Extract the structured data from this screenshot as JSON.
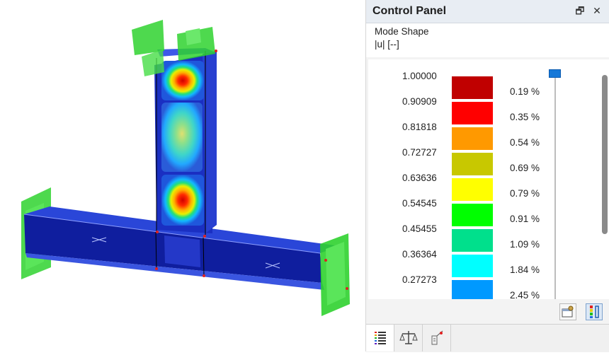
{
  "panel": {
    "title": "Control Panel",
    "restore_glyph": "🗗",
    "close_glyph": "✕",
    "result_type": "Mode Shape",
    "result_unit": "|u| [--]"
  },
  "legend": {
    "values": [
      "1.00000",
      "0.90909",
      "0.81818",
      "0.72727",
      "0.63636",
      "0.54545",
      "0.45455",
      "0.36364",
      "0.27273"
    ],
    "colors": [
      "#c00000",
      "#ff0000",
      "#ff9900",
      "#c8c800",
      "#ffff00",
      "#00ff00",
      "#00e08c",
      "#00ffff",
      "#0099ff"
    ],
    "percentages": [
      "0.19 %",
      "0.35 %",
      "0.54 %",
      "0.69 %",
      "0.79 %",
      "0.91 %",
      "1.09 %",
      "1.84 %",
      "2.45 %"
    ]
  },
  "footer_icons": [
    "settings-dialog-icon",
    "color-scale-icon"
  ],
  "tabs": [
    {
      "name": "color-scales-tab",
      "icon": "list-icon",
      "active": true
    },
    {
      "name": "factors-tab",
      "icon": "balance-icon",
      "active": false
    },
    {
      "name": "results-tab",
      "icon": "results-icon",
      "active": false
    }
  ],
  "colors": {
    "member_blue": "#1a2fc2",
    "support_green": "#22cc22",
    "panel_header": "#e8edf3"
  }
}
